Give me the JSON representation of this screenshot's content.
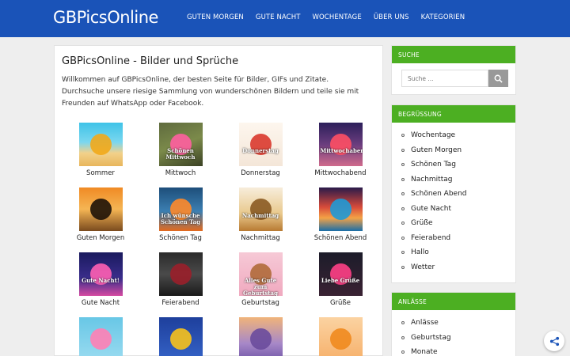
{
  "site": {
    "logo": "GBPicsOnline"
  },
  "nav": [
    "GUTEN MORGEN",
    "GUTE NACHT",
    "WOCHENTAGE",
    "ÜBER UNS",
    "KATEGORIEN"
  ],
  "main": {
    "title": "GBPicsOnline - Bilder und Sprüche",
    "intro": "Willkommen auf GBPicsOnline, der besten Seite für Bilder, GIFs und Zitate. Durchsuche unsere riesige Sammlung von wunderschönen Bildern und teile sie mit Freunden auf WhatsApp oder Facebook."
  },
  "tiles": [
    {
      "label": "Sommer",
      "bg": "linear-gradient(180deg,#3fc3e8 0%,#7ad7ef 45%,#f2d18a 70%,#e8b65c 100%)",
      "accent": "#f2a81a"
    },
    {
      "label": "Mittwoch",
      "bg": "linear-gradient(160deg,#5f6b3e 0%,#7b8a4a 50%,#3b4224 100%)",
      "accent": "#ff5fa0",
      "text": "Schönen Mittwoch"
    },
    {
      "label": "Donnerstag",
      "bg": "linear-gradient(180deg,#fdf6ee 0%,#f4e6d8 100%)",
      "accent": "#d9382e",
      "text": "Donnerstag"
    },
    {
      "label": "Mittwochabend",
      "bg": "linear-gradient(180deg,#2c1f5a 0%,#6a3d7e 50%,#d06b8c 100%)",
      "accent": "#ff4f64",
      "text": "Mittwochabend"
    },
    {
      "label": "Guten Morgen",
      "bg": "linear-gradient(180deg,#f08a24 0%,#f5b554 50%,#7a4a1e 100%)",
      "accent": "#1e1208"
    },
    {
      "label": "Schönen Tag",
      "bg": "linear-gradient(180deg,#1d4e7a 0%,#3c7fb2 55%,#e36a1e 100%)",
      "accent": "#ff8a2a",
      "text": "Ich wünsche Schönen Tag"
    },
    {
      "label": "Nachmittag",
      "bg": "linear-gradient(180deg,#f7eddb 0%,#e9c98d 60%,#b87a32 100%)",
      "accent": "#8a5a22",
      "text": "Nachmittag"
    },
    {
      "label": "Schönen Abend",
      "bg": "linear-gradient(180deg,#2a1a4a 0%,#d74a3a 45%,#f4a246 70%,#1a6ea8 100%)",
      "accent": "#1f9ad6"
    },
    {
      "label": "Gute Nacht",
      "bg": "linear-gradient(180deg,#1a1a5e 0%,#3a2d8c 60%,#d64aa1 100%)",
      "accent": "#ff5fb3",
      "text": "Gute Nacht!"
    },
    {
      "label": "Feierabend",
      "bg": "linear-gradient(180deg,#2b2b2b 0%,#4a4a4a 50%,#1a1a1a 100%)",
      "accent": "#9a1f2a"
    },
    {
      "label": "Geburtstag",
      "bg": "linear-gradient(180deg,#f6c9d6 0%,#f0a9bf 100%)",
      "accent": "#b06a3a",
      "text": "Alles Gute zum Geburtstag"
    },
    {
      "label": "Grüße",
      "bg": "linear-gradient(180deg,#1c1c2a 0%,#3a2233 100%)",
      "accent": "#ff3f86",
      "text": "Liebe Grüße"
    },
    {
      "label": "",
      "bg": "linear-gradient(180deg,#68c7e6 0%,#9adbf0 100%)",
      "accent": "#ff7fb5"
    },
    {
      "label": "",
      "bg": "linear-gradient(180deg,#1e3f9c 0%,#3563c7 100%)",
      "accent": "#f7c21c"
    },
    {
      "label": "",
      "bg": "linear-gradient(180deg,#f0b47a 0%,#a788c8 60%,#7257a8 100%)",
      "accent": "#6a4b9c"
    },
    {
      "label": "",
      "bg": "linear-gradient(180deg,#fbd3a2 0%,#f6b06a 100%)",
      "accent": "#f08a1e"
    }
  ],
  "sidebar": {
    "search": {
      "title": "SUCHE",
      "placeholder": "Suche ..."
    },
    "greeting": {
      "title": "BEGRÜSSUNG",
      "items": [
        "Wochentage",
        "Guten Morgen",
        "Schönen Tag",
        "Nachmittag",
        "Schönen Abend",
        "Gute Nacht",
        "Grüße",
        "Feierabend",
        "Hallo",
        "Wetter"
      ]
    },
    "occasions": {
      "title": "ANLÄSSE",
      "items": [
        "Anlässe",
        "Geburtstag",
        "Monate"
      ]
    }
  },
  "colors": {
    "header": "#1a53b8",
    "widget_header": "#4caf22",
    "search_button": "#999999"
  },
  "icons": {
    "search_button": "search-icon",
    "share_button": "share-icon"
  }
}
